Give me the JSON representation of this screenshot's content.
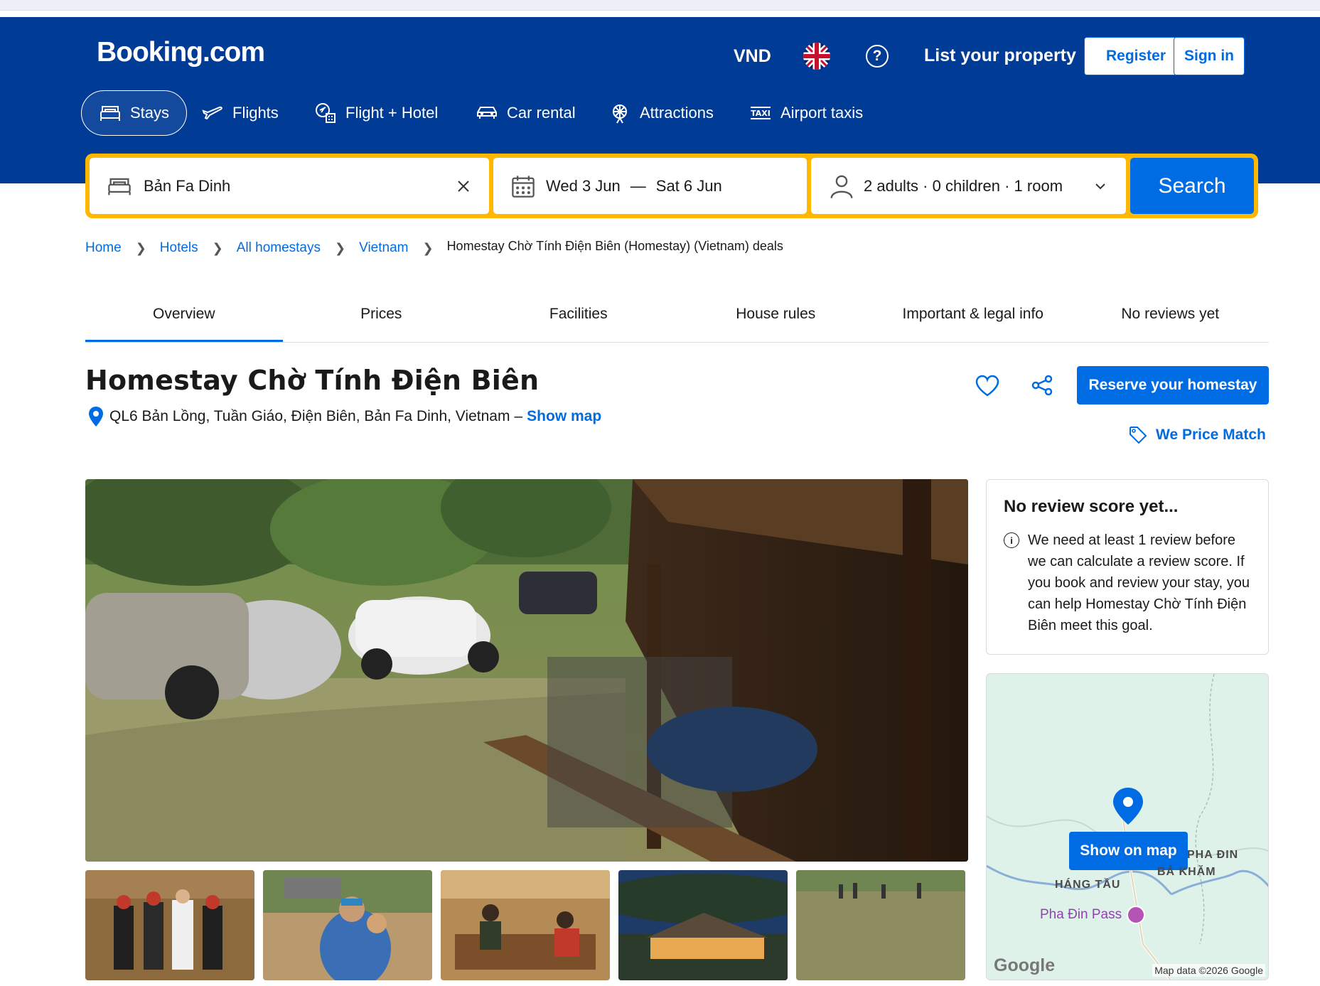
{
  "header": {
    "logo": "Booking.com",
    "currency": "VND",
    "help_symbol": "?",
    "list_property": "List your property",
    "register": "Register",
    "sign_in": "Sign in",
    "nav": [
      {
        "label": "Stays",
        "icon": "bed-icon",
        "active": true
      },
      {
        "label": "Flights",
        "icon": "plane-icon"
      },
      {
        "label": "Flight + Hotel",
        "icon": "flight-hotel-icon"
      },
      {
        "label": "Car rental",
        "icon": "car-icon"
      },
      {
        "label": "Attractions",
        "icon": "ferris-wheel-icon"
      },
      {
        "label": "Airport taxis",
        "icon": "taxi-icon"
      }
    ]
  },
  "search": {
    "destination": "Bản Fa Dinh",
    "checkin": "Wed 3 Jun",
    "dash": "—",
    "checkout": "Sat 6 Jun",
    "guests": "2 adults · 0 children · 1 room",
    "button": "Search",
    "accent": "#ffb700"
  },
  "breadcrumb": {
    "items": [
      "Home",
      "Hotels",
      "All homestays",
      "Vietnam"
    ],
    "current": "Homestay Chờ Tính Điện Biên (Homestay) (Vietnam) deals"
  },
  "tabs": [
    "Overview",
    "Prices",
    "Facilities",
    "House rules",
    "Important & legal info",
    "No reviews yet"
  ],
  "property": {
    "name": "Homestay Chờ Tính Điện Biên",
    "address": "QL6 Bản Lồng, Tuần Giáo, Điện Biên, Bản Fa Dinh, Vietnam",
    "address_dash": "–",
    "show_map": "Show map",
    "reserve": "Reserve your homestay",
    "price_match": "We Price Match"
  },
  "review": {
    "title": "No review score yet...",
    "text": "We need at least 1 review before we can calculate a review score. If you book and review your stay, you can help Homestay Chờ Tính Điện Biên meet this goal."
  },
  "map": {
    "button": "Show on map",
    "labels": [
      "PHA ĐIN",
      "BẢ KHĂM",
      "HÁNG TẦU"
    ],
    "pass": "Pha Đin Pass",
    "google": "Google",
    "data": "Map data ©2026 Google"
  },
  "colors": {
    "brand": "#003b95",
    "primary": "#006ce4"
  }
}
